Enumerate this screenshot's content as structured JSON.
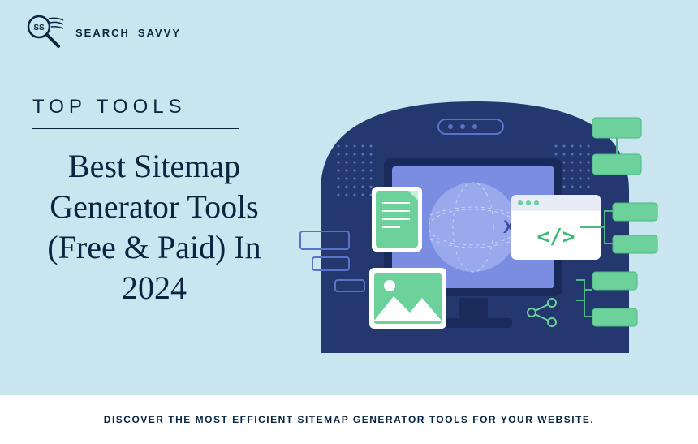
{
  "logo": {
    "text_left": "SEARCH",
    "text_right": "SAVVY",
    "badge": "SS"
  },
  "category": "TOP TOOLS",
  "title": "Best Sitemap Generator Tools (Free & Paid) In 2024",
  "illustration": {
    "center_label": "XML",
    "code_label": "</>"
  },
  "footer": "DISCOVER THE MOST EFFICIENT SITEMAP GENERATOR TOOLS FOR YOUR WEBSITE."
}
